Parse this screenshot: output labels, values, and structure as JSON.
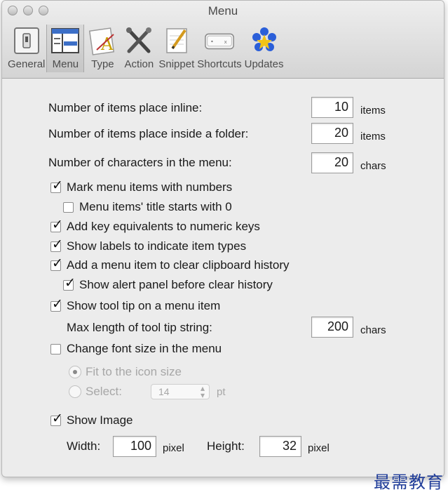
{
  "window": {
    "title": "Menu"
  },
  "toolbar": {
    "items": [
      {
        "label": "General"
      },
      {
        "label": "Menu"
      },
      {
        "label": "Type"
      },
      {
        "label": "Action"
      },
      {
        "label": "Snippet"
      },
      {
        "label": "Shortcuts"
      },
      {
        "label": "Updates"
      }
    ],
    "selected": "Menu"
  },
  "settings": {
    "inline_items": {
      "label": "Number of items place inline:",
      "value": "10",
      "unit": "items"
    },
    "folder_items": {
      "label": "Number of items place inside a folder:",
      "value": "20",
      "unit": "items"
    },
    "menu_chars": {
      "label": "Number of characters in the menu:",
      "value": "20",
      "unit": "chars"
    },
    "mark_numbers": {
      "label": "Mark menu items with numbers",
      "checked": true
    },
    "title_starts_zero": {
      "label": "Menu items' title starts with 0",
      "checked": false
    },
    "key_equivalents": {
      "label": "Add key equivalents to numeric keys",
      "checked": true
    },
    "show_labels": {
      "label": "Show labels to indicate item types",
      "checked": true
    },
    "clear_history_item": {
      "label": "Add a menu item to clear clipboard history",
      "checked": true
    },
    "alert_panel": {
      "label": "Show alert panel before clear history",
      "checked": true
    },
    "tooltip": {
      "label": "Show tool tip on a menu item",
      "checked": true
    },
    "tooltip_max": {
      "label": "Max length of tool tip string:",
      "value": "200",
      "unit": "chars"
    },
    "change_font": {
      "label": "Change font size in the menu",
      "checked": false
    },
    "fit_icon": {
      "label": "Fit to the icon size",
      "selected": true
    },
    "select_size": {
      "label": "Select:",
      "value": "14",
      "unit": "pt"
    },
    "show_image": {
      "label": "Show Image",
      "checked": true
    },
    "image_width": {
      "label": "Width:",
      "value": "100",
      "unit": "pixel"
    },
    "image_height": {
      "label": "Height:",
      "value": "32",
      "unit": "pixel"
    }
  },
  "watermark": "最需教育",
  "colors": {
    "window_bg": "#ececec",
    "watermark": "#1f3c99",
    "updates_icon": "#2b5fd9"
  }
}
